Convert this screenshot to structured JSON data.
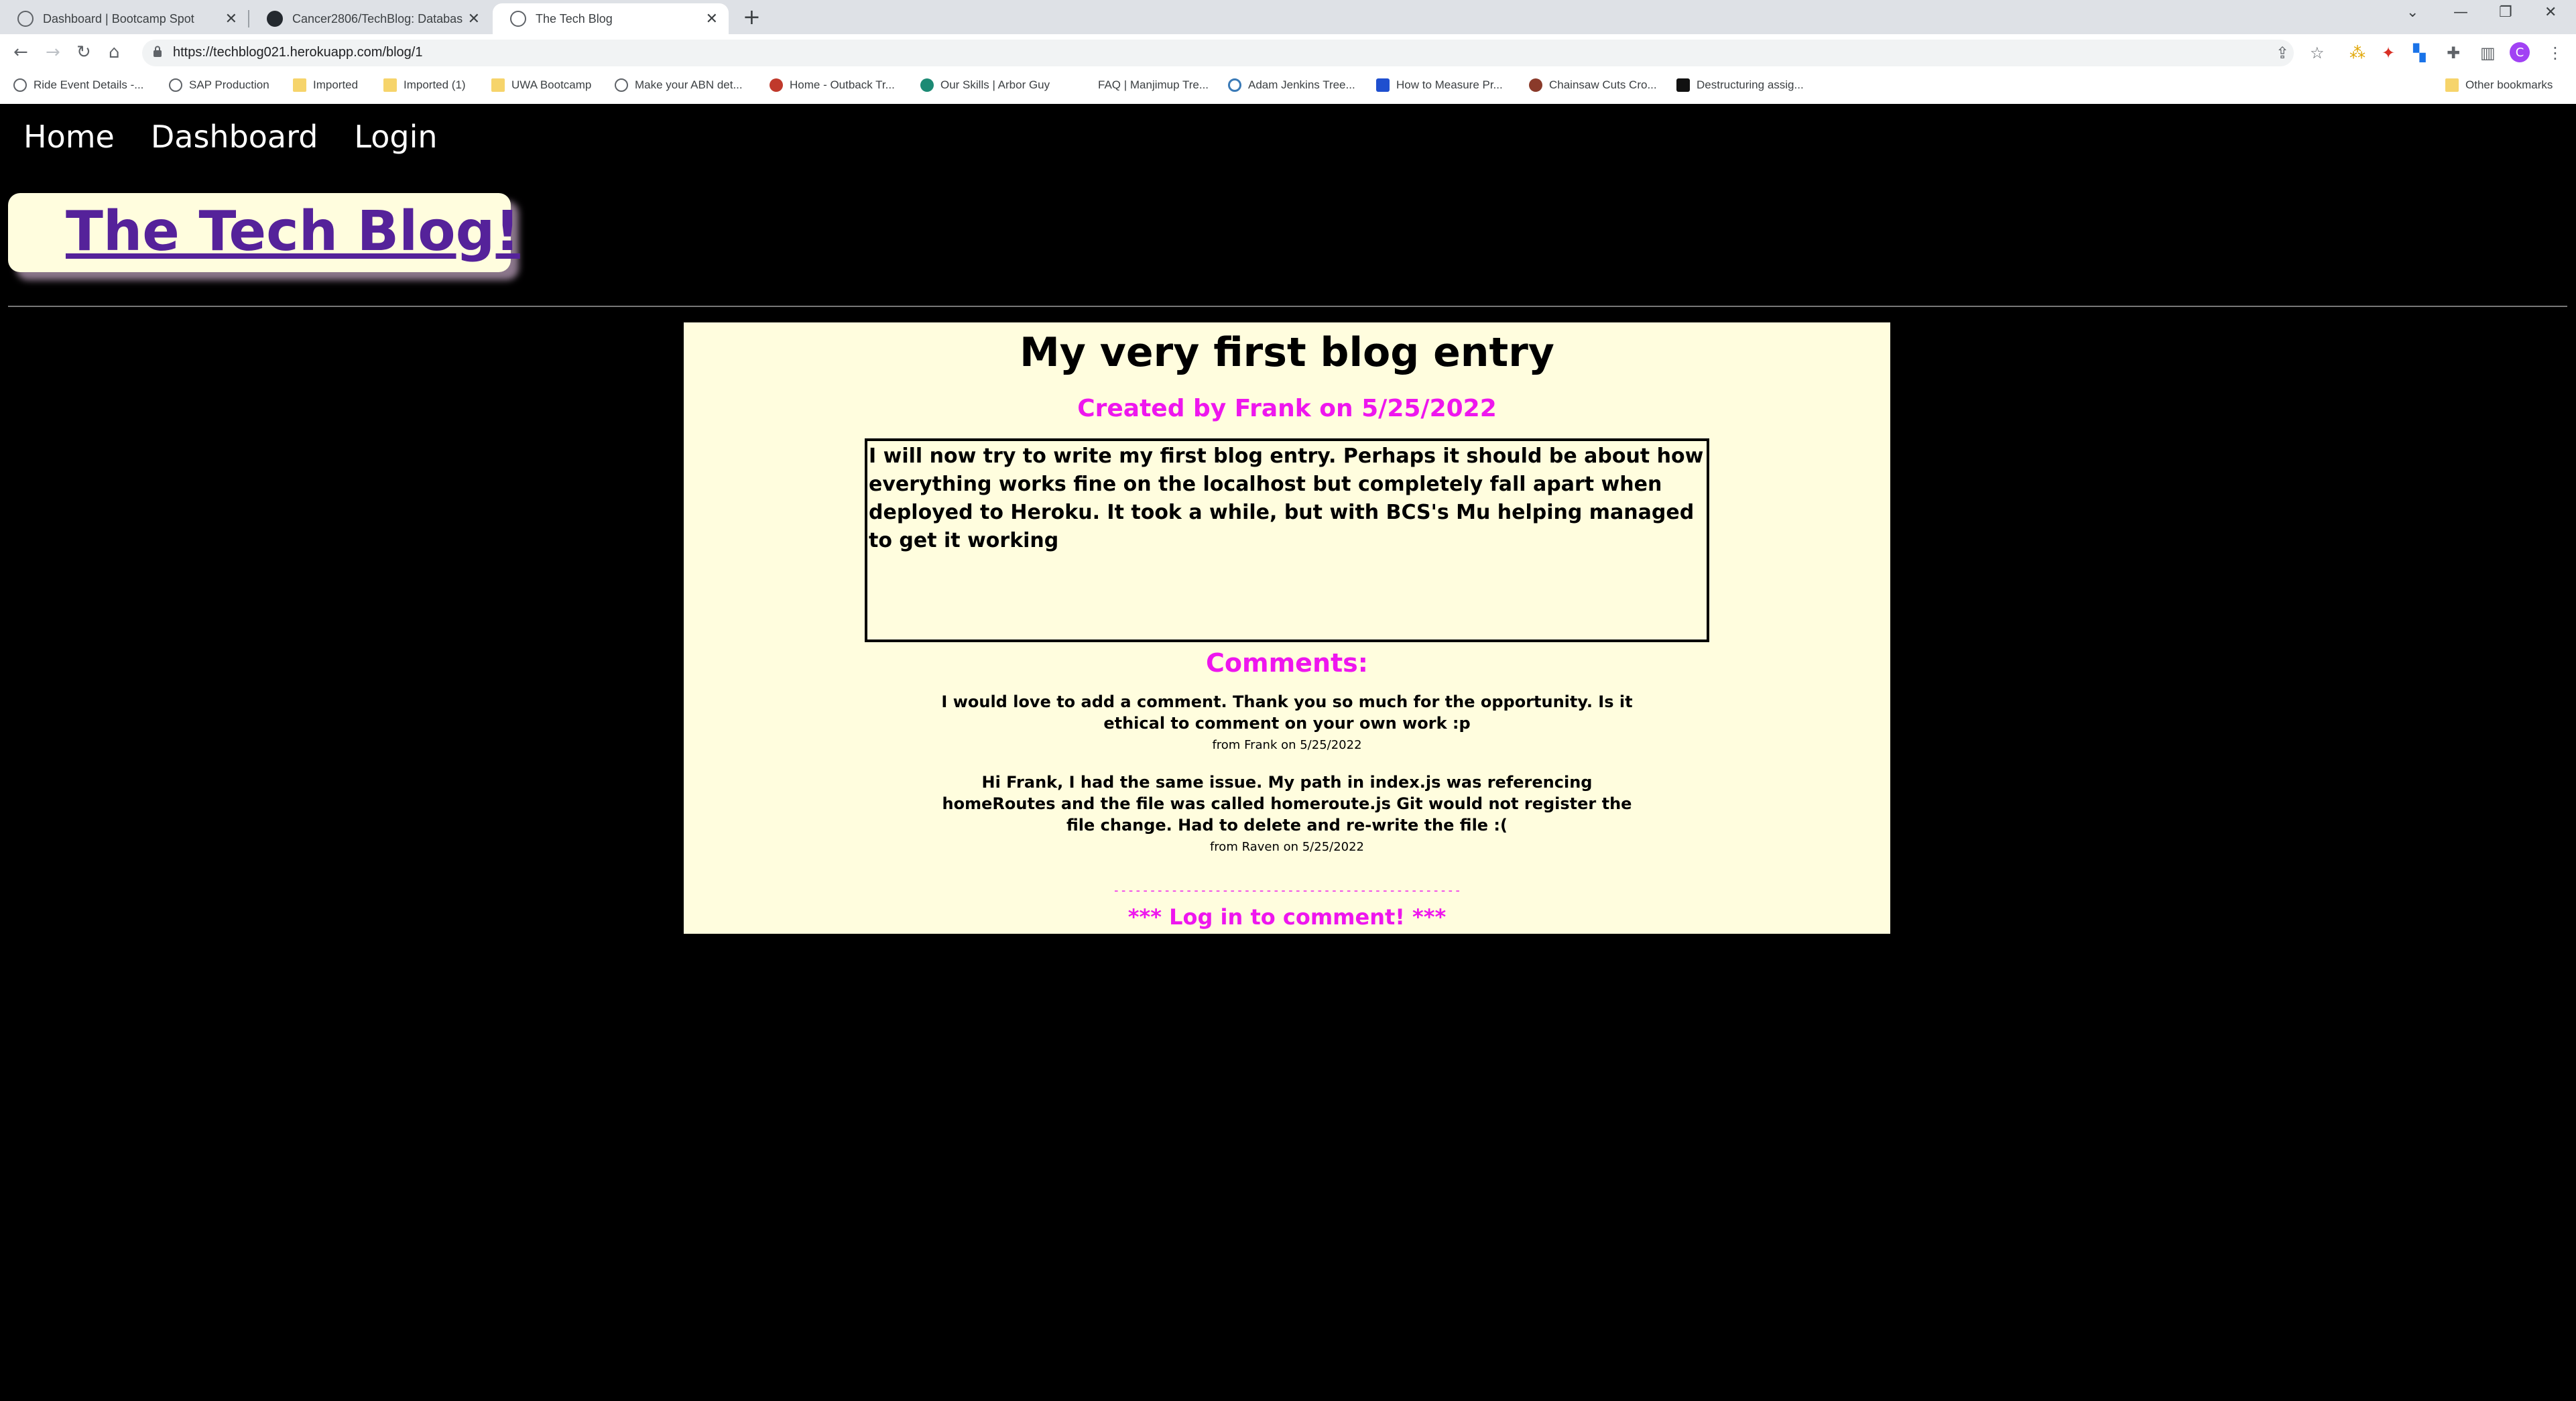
{
  "browser": {
    "tabs": [
      {
        "label": "Dashboard | Bootcamp Spot"
      },
      {
        "label": "Cancer2806/TechBlog: Databas"
      },
      {
        "label": "The Tech Blog"
      }
    ],
    "url": "https://techblog021.herokuapp.com/blog/1",
    "bookmarks": [
      {
        "label": "Ride Event Details -...",
        "icon": "globe-icon"
      },
      {
        "label": "SAP Production",
        "icon": "globe-icon"
      },
      {
        "label": "Imported",
        "icon": "folder-icon"
      },
      {
        "label": "Imported (1)",
        "icon": "folder-icon"
      },
      {
        "label": "UWA Bootcamp",
        "icon": "folder-icon"
      },
      {
        "label": "Make your ABN det...",
        "icon": "globe-icon"
      },
      {
        "label": "Home - Outback Tr...",
        "icon": "site-icon"
      },
      {
        "label": "Our Skills | Arbor Guy",
        "icon": "site-icon"
      },
      {
        "label": "FAQ | Manjimup Tre...",
        "icon": "site-icon"
      },
      {
        "label": "Adam Jenkins Tree...",
        "icon": "wordpress-icon"
      },
      {
        "label": "How to Measure Pr...",
        "icon": "site-icon"
      },
      {
        "label": "Chainsaw Cuts Cro...",
        "icon": "site-icon"
      },
      {
        "label": "Destructuring assig...",
        "icon": "site-icon"
      }
    ],
    "other_bookmarks": "Other bookmarks",
    "profile_initial": "C"
  },
  "site": {
    "nav": {
      "home": "Home",
      "dashboard": "Dashboard",
      "login": "Login"
    },
    "brand": "The Tech Blog!"
  },
  "post": {
    "title": "My very first blog entry",
    "meta": "Created by Frank on 5/25/2022",
    "body": "I will now try to write my first blog entry. Perhaps it should be about how everything works fine on the localhost but completely fall apart when deployed to Heroku. It took a while, but with BCS's Mu helping managed to get it working",
    "comments_heading": "Comments:",
    "comments": [
      {
        "text": "I would love to add a comment. Thank you so much for the opportunity. Is it ethical to comment on your own work :p",
        "meta": "from Frank on 5/25/2022"
      },
      {
        "text": "Hi Frank, I had the same issue. My path in index.js was referencing homeRoutes and the file was called homeroute.js Git would not register the file change. Had to delete and re-write the file :(",
        "meta": "from Raven on 5/25/2022"
      }
    ],
    "divider": "------------------------------------------------",
    "login_prompt": "*** Log in to comment! ***"
  },
  "colors": {
    "accent": "#ee16ee",
    "brand": "#55229a",
    "card": "#fffdde",
    "background": "#000000"
  }
}
